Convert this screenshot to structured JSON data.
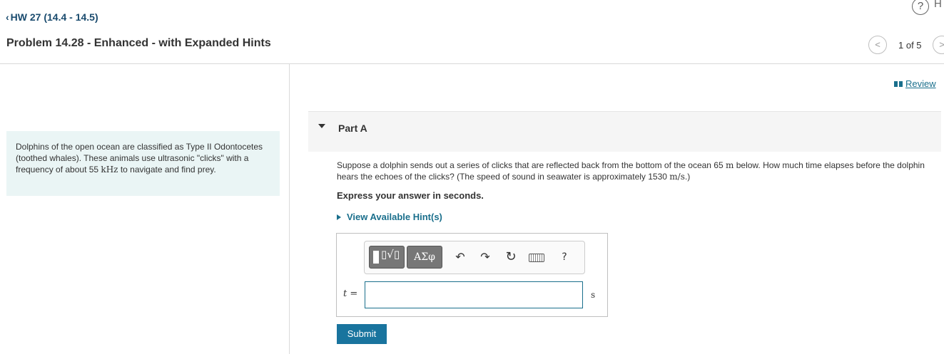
{
  "header": {
    "back_link": "HW 27 (14.4 - 14.5)",
    "help_icon_char": "?",
    "help_letter": "H",
    "problem_title": "Problem 14.28 - Enhanced - with Expanded Hints",
    "prev_char": "<",
    "next_char": ">",
    "page_counter": "1 of 5"
  },
  "intro": {
    "text_before": "Dolphins of the open ocean are classified as Type II Odontocetes (toothed whales). These animals use ultrasonic \"clicks\" with a frequency of about 55 ",
    "unit": "kHz",
    "text_after": " to navigate and find prey."
  },
  "review": {
    "label": "Review"
  },
  "part": {
    "title": "Part A",
    "question_1": "Suppose a dolphin sends out a series of clicks that are reflected back from the bottom of the ocean 65 ",
    "question_unit_1": "m",
    "question_2": " below. How much time elapses before the dolphin hears the echoes of the clicks? (The speed of sound in seawater is approximately 1530 ",
    "question_unit_2": "m/s",
    "question_3": ".)",
    "express": "Express your answer in seconds.",
    "hints": "View Available Hint(s)"
  },
  "toolbar": {
    "templates_symbol": "▯√▯",
    "symbols_label": "ΑΣφ",
    "undo": "↶",
    "redo": "↷",
    "reset": "↻",
    "help": "?"
  },
  "answer": {
    "variable": "t",
    "equals": " =",
    "value": "",
    "unit": "s",
    "submit": "Submit"
  },
  "colors": {
    "accent": "#19749e",
    "intro_bg": "#eaf5f5",
    "link": "#1a6f8c"
  }
}
